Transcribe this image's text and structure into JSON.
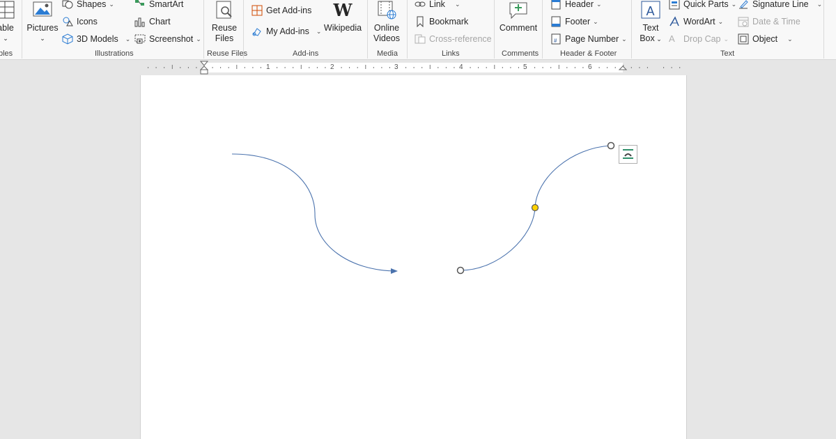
{
  "ribbon": {
    "groups": {
      "tables": "bles",
      "illustrations": "Illustrations",
      "reuse_files": "Reuse Files",
      "add_ins": "Add-ins",
      "media": "Media",
      "links": "Links",
      "comments": "Comments",
      "header_footer": "Header & Footer",
      "text": "Text"
    },
    "table_label": "able",
    "pictures_label": "Pictures",
    "shapes_label": "Shapes",
    "icons_label": "Icons",
    "models_label": "3D Models",
    "smartart_label": "SmartArt",
    "chart_label": "Chart",
    "screenshot_label": "Screenshot",
    "reuse_label_1": "Reuse",
    "reuse_label_2": "Files",
    "get_addins_label": "Get Add-ins",
    "my_addins_label": "My Add-ins",
    "wikipedia_label": "Wikipedia",
    "online_videos_label_1": "Online",
    "online_videos_label_2": "Videos",
    "link_label": "Link",
    "bookmark_label": "Bookmark",
    "crossref_label": "Cross-reference",
    "comment_label": "Comment",
    "header_label": "Header",
    "footer_label": "Footer",
    "page_number_label": "Page Number",
    "textbox_label_1": "Text",
    "textbox_label_2": "Box",
    "quick_parts_label": "Quick Parts",
    "wordart_label": "WordArt",
    "dropcap_label": "Drop Cap",
    "signature_label": "Signature Line",
    "datetime_label": "Date & Time",
    "object_label": "Object"
  },
  "ruler": {
    "numbers": [
      "1",
      "2",
      "3",
      "4",
      "5",
      "6"
    ]
  },
  "colors": {
    "connector": "#4a72ad",
    "handle_yellow": "#ffd200",
    "accent": "#2b579a"
  }
}
